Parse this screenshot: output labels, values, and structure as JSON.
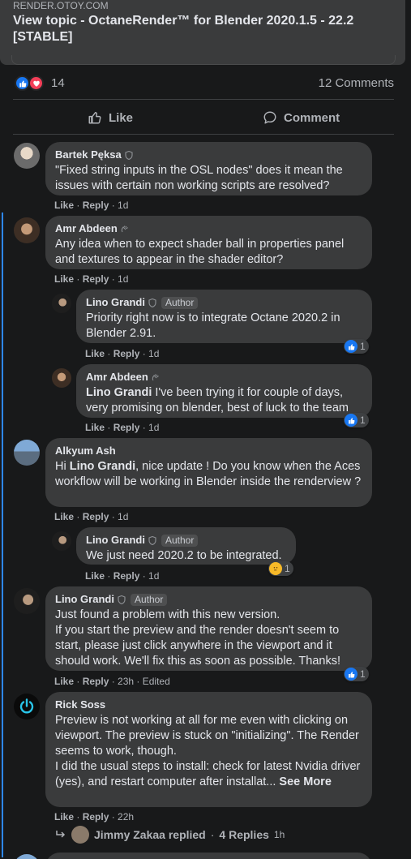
{
  "link_card": {
    "source": "RENDER.OTOY.COM",
    "title": "View topic - OctaneRender™ for Blender 2020.1.5 - 22.2 [STABLE]"
  },
  "stats": {
    "reaction_count": "14",
    "comments_count": "12 Comments"
  },
  "actions": {
    "like_label": "Like",
    "comment_label": "Comment"
  },
  "colors": {
    "background": "#18191a",
    "bubble": "#3a3b3c",
    "accent": "#2d88ff",
    "like": "#1877f2",
    "love": "#f33e58"
  },
  "comments": [
    {
      "name": "Bartek Pęksa",
      "text": "\"Fixed string inputs in the OSL nodes\" does it mean the issues with certain non working scripts are resolved?",
      "like": "Like",
      "reply": "Reply",
      "time": "1d"
    },
    {
      "name": "Amr Abdeen",
      "text": "Any idea when to expect shader ball in properties panel and textures to appear in the shader editor?",
      "like": "Like",
      "reply": "Reply",
      "time": "1d"
    },
    {
      "name": "Lino Grandi",
      "tag": "Author",
      "text": "Priority right now is to integrate Octane 2020.2 in Blender 2.91.",
      "like": "Like",
      "reply": "Reply",
      "time": "1d",
      "reactions": "1"
    },
    {
      "name": "Amr Abdeen",
      "mention": "Lino Grandi",
      "text": " I've been trying it for couple of days, very promising on blender, best of luck to the team",
      "like": "Like",
      "reply": "Reply",
      "time": "1d",
      "reactions": "1"
    },
    {
      "name": "Alkyum Ash",
      "pre": "Hi ",
      "mention": "Lino Grandi",
      "text": ", nice update ! Do you know when the Aces workflow will be working in Blender inside the renderview ?",
      "like": "Like",
      "reply": "Reply",
      "time": "1d"
    },
    {
      "name": "Lino Grandi",
      "tag": "Author",
      "text": "We just need 2020.2 to be integrated.",
      "like": "Like",
      "reply": "Reply",
      "time": "1d",
      "reactions": "1"
    },
    {
      "name": "Lino Grandi",
      "tag": "Author",
      "text": "Just found a problem with this new version.\nIf you start the preview and the render doesn't seem to start, please just click anywhere in the viewport and it should work. We'll fix this as soon as possible. Thanks!",
      "like": "Like",
      "reply": "Reply",
      "time": "23h",
      "edited": "Edited",
      "reactions": "1"
    },
    {
      "name": "Rick Soss",
      "text": "Preview is not working at all for me even with clicking on viewport. The preview is stuck on \"initializing\". The Render seems to work, though.\nI did the usual steps to install: check for latest Nvidia driver (yes), and restart computer after installat...",
      "see_more": "See More",
      "like": "Like",
      "reply": "Reply",
      "time": "22h"
    }
  ],
  "replied_row": {
    "name": "Jimmy Zakaa replied",
    "count": "4 Replies",
    "time": "1h"
  }
}
